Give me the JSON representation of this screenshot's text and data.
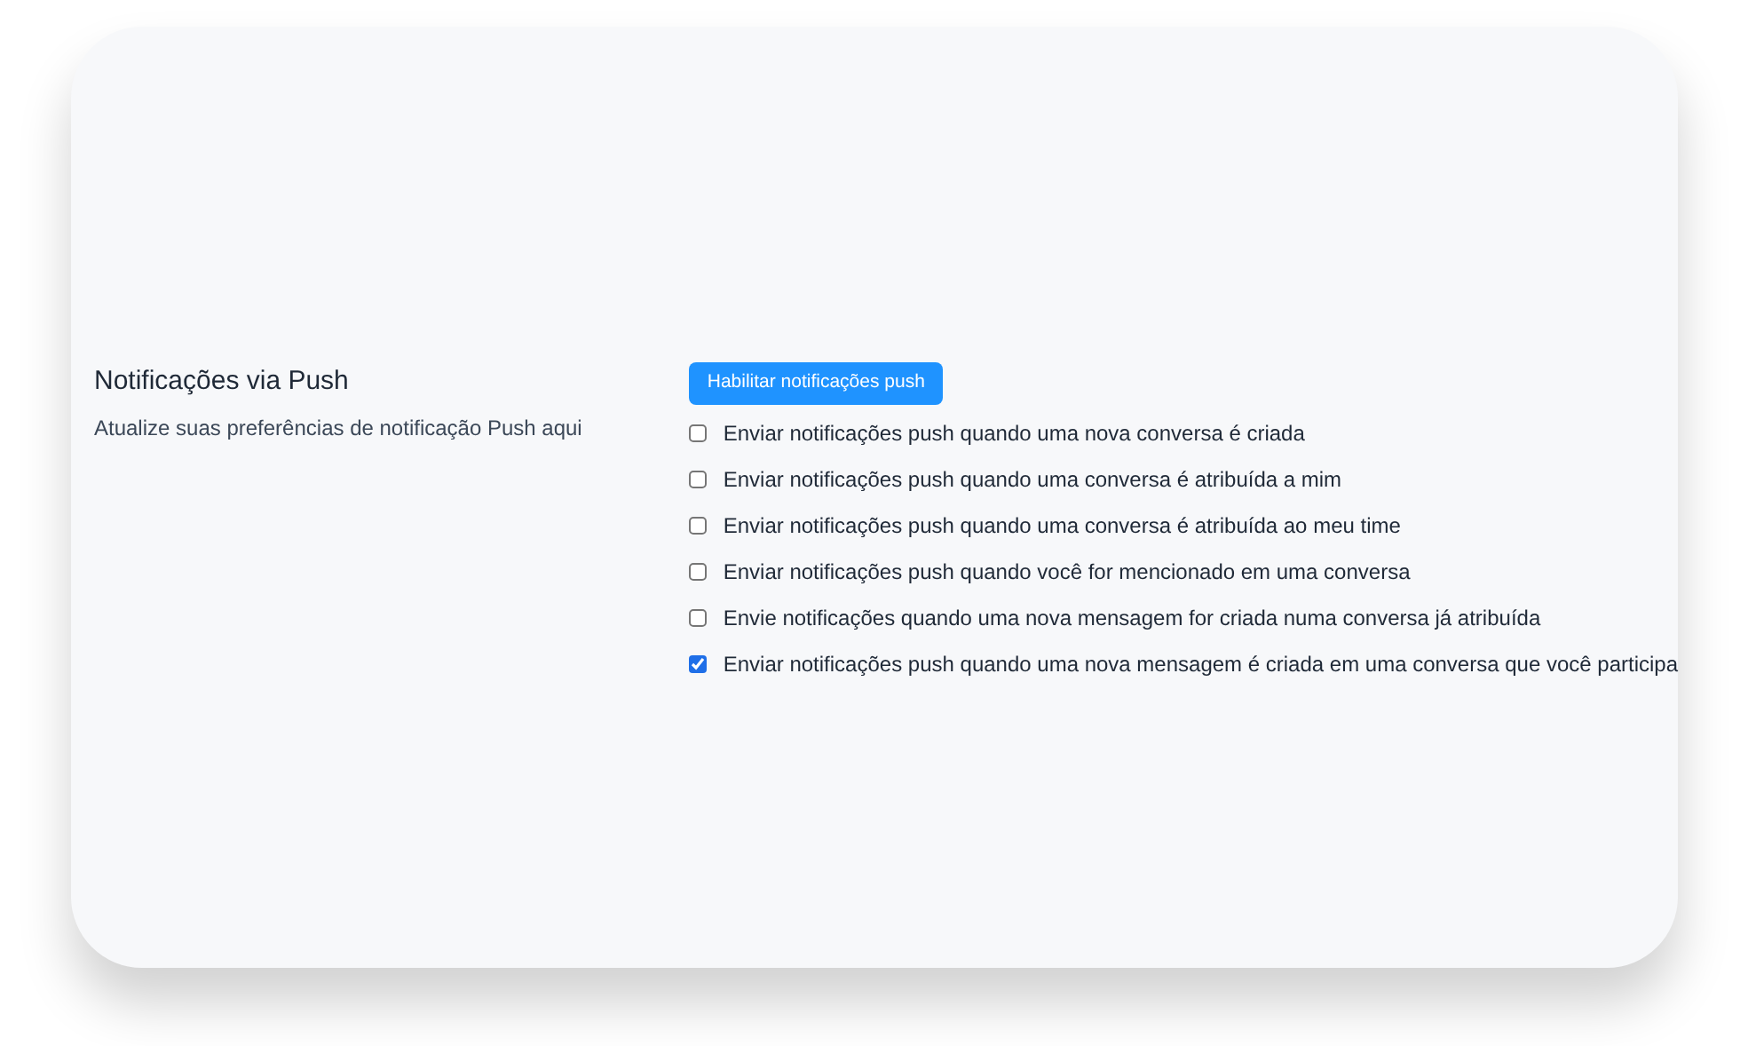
{
  "section": {
    "title": "Notificações via Push",
    "description": "Atualize suas preferências de notificação Push aqui"
  },
  "enable_button": "Habilitar notificações push",
  "options": [
    {
      "label": "Enviar notificações push quando uma nova conversa é criada",
      "checked": false
    },
    {
      "label": "Enviar notificações push quando uma conversa é atribuída a mim",
      "checked": false
    },
    {
      "label": "Enviar notificações push quando uma conversa é atribuída ao meu time",
      "checked": false
    },
    {
      "label": "Enviar notificações push quando você for mencionado em uma conversa",
      "checked": false
    },
    {
      "label": "Envie notificações quando uma nova mensagem for criada numa conversa já atribuída",
      "checked": false
    },
    {
      "label": "Enviar notificações push quando uma nova mensagem é criada em uma conversa que você participa",
      "checked": true
    }
  ]
}
